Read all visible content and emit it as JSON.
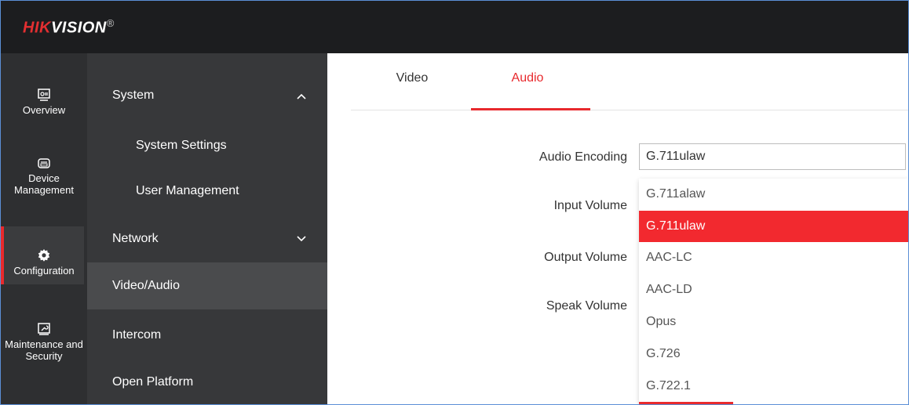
{
  "brand": {
    "logo_red": "HIK",
    "logo_white": "VISION",
    "logo_mark": "®"
  },
  "nav": [
    {
      "label": "Overview",
      "icon": "monitor-icon"
    },
    {
      "label": "Device Management",
      "icon": "device-icon"
    },
    {
      "label": "Configuration",
      "icon": "gear-icon"
    },
    {
      "label": "Maintenance and Security",
      "icon": "wrench-icon"
    }
  ],
  "menu": {
    "system": "System",
    "system_settings": "System Settings",
    "user_management": "User Management",
    "network": "Network",
    "video_audio": "Video/Audio",
    "intercom": "Intercom",
    "open_platform": "Open Platform"
  },
  "tabs": {
    "video": "Video",
    "audio": "Audio"
  },
  "form": {
    "audio_encoding_label": "Audio Encoding",
    "audio_encoding_value": "G.711ulaw",
    "input_volume_label": "Input Volume",
    "output_volume_label": "Output Volume",
    "speak_volume_label": "Speak Volume"
  },
  "dropdown_options": [
    "G.711alaw",
    "G.711ulaw",
    "AAC-LC",
    "AAC-LD",
    "Opus",
    "G.726",
    "G.722.1"
  ],
  "selected_option": "G.711ulaw",
  "colors": {
    "accent": "#e8292d",
    "topbar": "#1c1d1f",
    "iconbar": "#2e2f31",
    "menubar": "#37383a"
  }
}
